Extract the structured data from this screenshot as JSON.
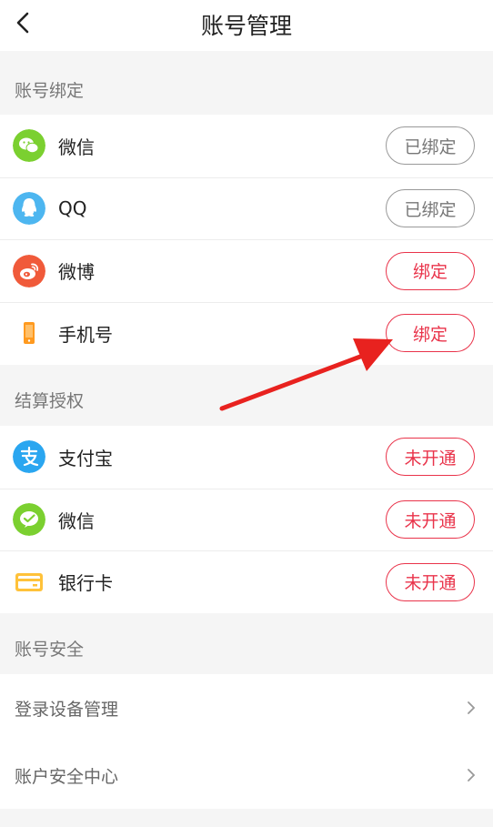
{
  "header": {
    "title": "账号管理"
  },
  "sections": {
    "binding": {
      "label": "账号绑定"
    },
    "settlement": {
      "label": "结算授权"
    },
    "security": {
      "label": "账号安全"
    }
  },
  "binding_items": [
    {
      "name": "微信",
      "status": "已绑定",
      "icon": "wechat-icon",
      "color": "#7bd030"
    },
    {
      "name": "QQ",
      "status": "已绑定",
      "icon": "qq-icon",
      "color": "#4db6f0"
    },
    {
      "name": "微博",
      "status": "绑定",
      "icon": "weibo-icon",
      "color": "#f05a3a"
    },
    {
      "name": "手机号",
      "status": "绑定",
      "icon": "phone-icon",
      "color": "#ff9a1f"
    }
  ],
  "settlement_items": [
    {
      "name": "支付宝",
      "status": "未开通",
      "icon": "alipay-icon",
      "color": "#2aa6f0"
    },
    {
      "name": "微信",
      "status": "未开通",
      "icon": "wechat-pay-icon",
      "color": "#7bd030"
    },
    {
      "name": "银行卡",
      "status": "未开通",
      "icon": "bank-card-icon",
      "color": "#ffc23a"
    }
  ],
  "security_items": [
    {
      "label": "登录设备管理"
    },
    {
      "label": "账户安全中心"
    }
  ],
  "colors": {
    "accent": "#e9334a",
    "muted": "#999999"
  }
}
